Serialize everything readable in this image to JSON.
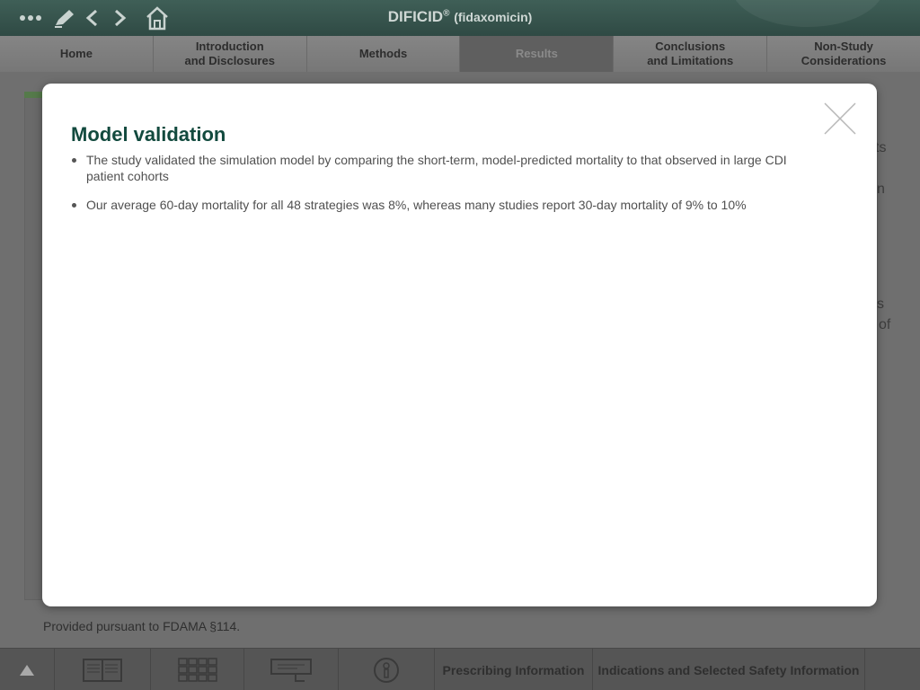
{
  "header": {
    "title": "DIFICID",
    "title_mark": "®",
    "subtitle": "(fidaxomicin)",
    "icons": [
      "more-icon",
      "pen-icon",
      "back-icon",
      "forward-icon",
      "home-icon"
    ]
  },
  "nav": {
    "tabs": [
      {
        "label": "Home"
      },
      {
        "label": "Introduction\nand Disclosures"
      },
      {
        "label": "Methods"
      },
      {
        "label": "Results",
        "active": true
      },
      {
        "label": "Conclusions\nand Limitations"
      },
      {
        "label": "Non-Study\nConsiderations"
      }
    ]
  },
  "background": {
    "fragments": [
      "ts",
      "n",
      "s",
      "of"
    ]
  },
  "footer": {
    "note": "Provided pursuant to FDAMA §114."
  },
  "bottombar": {
    "prescribing_label": "Prescribing Information",
    "indications_label": "Indications and Selected Safety Information"
  },
  "modal": {
    "title": "Model validation",
    "bullets": [
      "The study validated the simulation model by comparing the short-term, model-predicted mortality to that observed in large CDI patient cohorts",
      "Our average 60-day mortality for all 48 strategies was 8%, whereas many studies report 30-day mortality of 9% to 10%"
    ]
  },
  "colors": {
    "modal_title": "#124a3e",
    "topbar": "#3f5f57"
  }
}
